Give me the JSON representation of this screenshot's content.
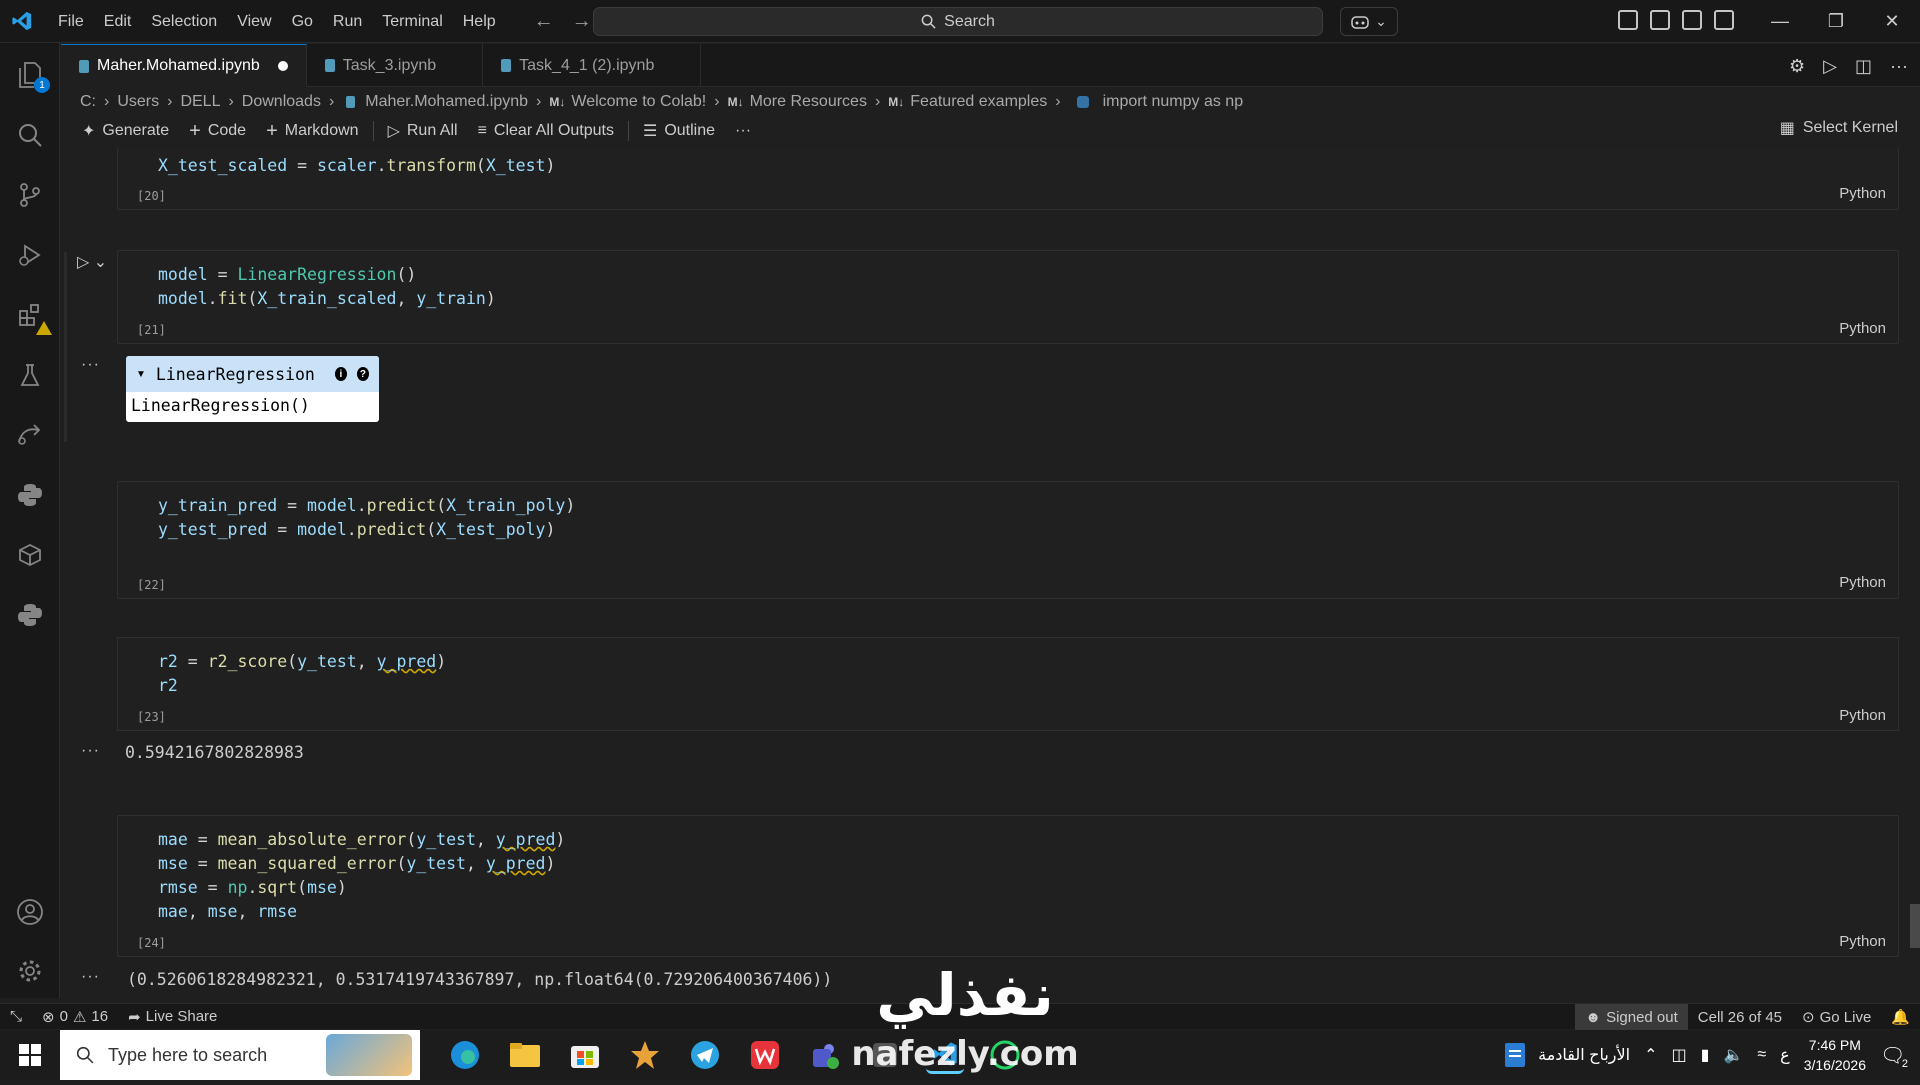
{
  "menu": [
    "File",
    "Edit",
    "Selection",
    "View",
    "Go",
    "Run",
    "Terminal",
    "Help"
  ],
  "search": {
    "label": "Search"
  },
  "tabs": [
    {
      "label": "Maher.Mohamed.ipynb",
      "modified": true
    },
    {
      "label": "Task_3.ipynb"
    },
    {
      "label": "Task_4_1 (2).ipynb"
    }
  ],
  "activity": {
    "explorer_badge": "1"
  },
  "breadcrumb": {
    "items": [
      "C:",
      "Users",
      "DELL",
      "Downloads",
      "Maher.Mohamed.ipynb",
      "Welcome to Colab!",
      "More Resources",
      "Featured examples",
      "import numpy as np"
    ],
    "md_tag": "M↓"
  },
  "toolbar": {
    "generate": "Generate",
    "code": "Code",
    "markdown": "Markdown",
    "run_all": "Run All",
    "clear_outputs": "Clear All Outputs",
    "outline": "Outline",
    "more": "···",
    "select_kernel": "Select Kernel"
  },
  "cells": [
    {
      "exec": "[20]",
      "lang": "Python",
      "lines": [
        "X_test_scaled = scaler.transform(X_test)"
      ]
    },
    {
      "exec": "[21]",
      "lang": "Python",
      "lines": [
        "model = LinearRegression()",
        "model.fit(X_train_scaled, y_train)"
      ],
      "widget": {
        "title": "LinearRegression",
        "body": "LinearRegression()",
        "info": "i",
        "help": "?"
      }
    },
    {
      "exec": "[22]",
      "lang": "Python",
      "lines": [
        "y_train_pred = model.predict(X_train_poly)",
        "y_test_pred = model.predict(X_test_poly)"
      ]
    },
    {
      "exec": "[23]",
      "lang": "Python",
      "lines": [
        "r2 = r2_score(y_test, y_pred)",
        "r2"
      ],
      "output": "0.5942167802828983"
    },
    {
      "exec": "[24]",
      "lang": "Python",
      "lines": [
        "mae = mean_absolute_error(y_test, y_pred)",
        "mse = mean_squared_error(y_test, y_pred)",
        "rmse = np.sqrt(mse)",
        "mae, mse, rmse"
      ],
      "output": "(0.5260618284982321, 0.5317419743367897, np.float64(0.729206400367406))"
    }
  ],
  "output_dots": "···",
  "statusbar": {
    "errors": "0",
    "warnings": "16",
    "live_share": "Live Share",
    "signed_out": "Signed out",
    "cell_pos": "Cell 26 of 45",
    "go_live": "Go Live"
  },
  "taskbar": {
    "search_placeholder": "Type here to search",
    "tray_app_label": "الأرباح القادمة",
    "lang_indicator": "ع",
    "time": "7:46 PM",
    "date": "3/16/2026",
    "notif_count": "2"
  },
  "watermark": {
    "arabic": "نفذلي",
    "latin": "nafezly.com"
  },
  "colors": {
    "accent": "#0078d4",
    "editor_bg": "#1f1f1f",
    "widget_head": "#c9e2f7",
    "warning": "#cca700"
  }
}
